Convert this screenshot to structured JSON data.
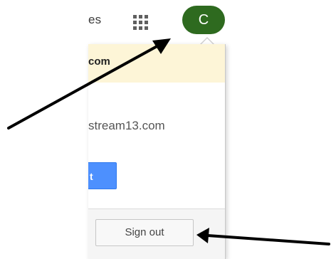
{
  "topbar": {
    "link_text": "es",
    "avatar_letter": "C",
    "apps_icon": "grid-icon"
  },
  "dropdown": {
    "warning_text": "com",
    "account_email": "stream13.com",
    "primary_button_label": "t",
    "signout_label": "Sign out"
  },
  "annotations": {
    "arrow_color": "#000000",
    "arrows": [
      "points-to-avatar",
      "points-to-signout"
    ]
  },
  "colors": {
    "avatar_bg": "#2e6a1f",
    "warning_bg": "#fdf5d7",
    "primary_button": "#4d90fe",
    "footer_bg": "#f5f5f5"
  }
}
